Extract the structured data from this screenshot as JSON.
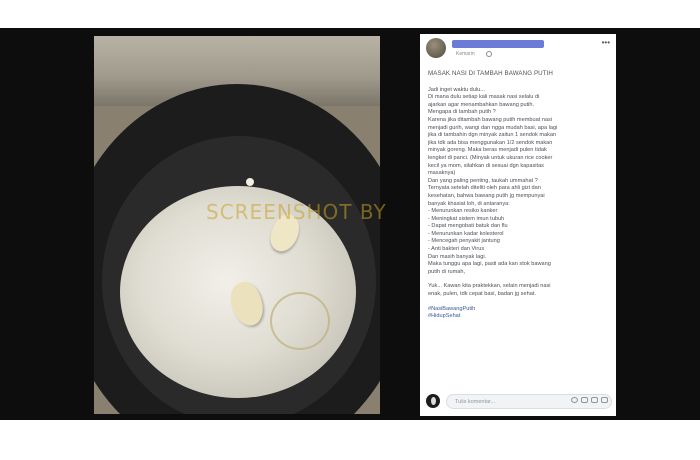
{
  "watermark": "SCREENSHOT BY",
  "post": {
    "time": "Kemarin",
    "more_label": "•••",
    "title": "MASAK NASI DI TAMBAH BAWANG PUTIH",
    "lines": [
      "Jadi inget waktu dulu...",
      "Di mana dulu setiap kali masak nasi selalu di",
      "ajarkan agar menambahkan bawang putih.",
      "Mengapa di tambah putih ?",
      "Karena jika ditambah bawang putih membuat nasi",
      "menjadi gurih, wangi dan ngga mudah basi, apa lagi",
      "jika di tambahin dgn minyak zaitun 1 sendok makan",
      "jika tdk ada bisa menggunakan 1/2 sendok makan",
      "minyak goreng. Maka beras menjadi pulen tidak",
      "lengket di panci. (Minyak untuk ukuran rice cooker",
      "kecil ya mom, silahkan di sesuai dgn kapasitas",
      "masaknya)"
    ],
    "lines2": [
      "Dan yang paling penting, taukah ummahat ?",
      "Ternyata setelah diteliti oleh para ahli gizi dan",
      "kesehatan, bahwa bawang putih jg mempunyai",
      "banyak khasiat loh, di antaranya:",
      "- Menurunkan resiko kanker",
      "- Meningkat sistem imun tubuh",
      "- Dapat mengobati batuk dan flu",
      "- Menurunkan kadar kolesterol",
      "- Mencegah penyakit jantung",
      "- Anti bakteri dan Virus",
      "Dan masih banyak lagi.",
      "Maka tunggu apa lagi, pasti ada kan stok bawang",
      "putih di rumah,"
    ],
    "lines3": [
      "Yuk... Kawan kita praktekkan, selain menjadi nasi",
      "enak, pulen, tdk cepat basi, badan jg sehat."
    ],
    "hashtags": [
      "#NasiBawangPutih",
      "#HidupSehat"
    ],
    "comment_placeholder": "Tulis komentar..."
  },
  "colors": {
    "background": "#0d0d0d",
    "link": "#385898",
    "redaction": "#6a7bd8"
  }
}
